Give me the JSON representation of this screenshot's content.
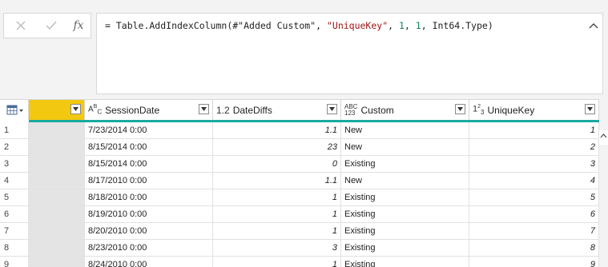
{
  "formula_bar": {
    "tokens": [
      {
        "t": "= Table.AddIndexColumn(#",
        "c": "plain"
      },
      {
        "t": "\"Added Custom\"",
        "c": "plain"
      },
      {
        "t": ", ",
        "c": "plain"
      },
      {
        "t": "\"UniqueKey\"",
        "c": "str"
      },
      {
        "t": ", ",
        "c": "plain"
      },
      {
        "t": "1",
        "c": "num"
      },
      {
        "t": ", ",
        "c": "plain"
      },
      {
        "t": "1",
        "c": "num"
      },
      {
        "t": ", Int64.Type)",
        "c": "plain"
      }
    ],
    "fx_label": "fx"
  },
  "columns": [
    {
      "id": "blank",
      "type_icon": "",
      "name": ""
    },
    {
      "id": "sessiondate",
      "type_icon": "ABC",
      "name": "SessionDate"
    },
    {
      "id": "datediffs",
      "type_icon": "1.2",
      "name": "DateDiffs"
    },
    {
      "id": "custom",
      "type_icon": "ABC/123",
      "name": "Custom"
    },
    {
      "id": "uniquekey",
      "type_icon": "123",
      "name": "UniqueKey"
    }
  ],
  "rows": [
    {
      "n": "1",
      "date": "7/23/2014 0:00",
      "diff": "1.1",
      "custom": "New",
      "key": "1"
    },
    {
      "n": "2",
      "date": "8/15/2014 0:00",
      "diff": "23",
      "custom": "New",
      "key": "2"
    },
    {
      "n": "3",
      "date": "8/15/2014 0:00",
      "diff": "0",
      "custom": "Existing",
      "key": "3"
    },
    {
      "n": "4",
      "date": "8/17/2010 0:00",
      "diff": "1.1",
      "custom": "New",
      "key": "4"
    },
    {
      "n": "5",
      "date": "8/18/2010 0:00",
      "diff": "1",
      "custom": "Existing",
      "key": "5"
    },
    {
      "n": "6",
      "date": "8/19/2010 0:00",
      "diff": "1",
      "custom": "Existing",
      "key": "6"
    },
    {
      "n": "7",
      "date": "8/20/2010 0:00",
      "diff": "1",
      "custom": "Existing",
      "key": "7"
    },
    {
      "n": "8",
      "date": "8/23/2010 0:00",
      "diff": "3",
      "custom": "Existing",
      "key": "8"
    },
    {
      "n": "9",
      "date": "8/24/2010 0:00",
      "diff": "1",
      "custom": "Existing",
      "key": "9"
    }
  ],
  "colors": {
    "accent_teal": "#1aa9a0",
    "selected_header": "#f2c811",
    "string_token": "#a31515",
    "number_token": "#098658"
  }
}
